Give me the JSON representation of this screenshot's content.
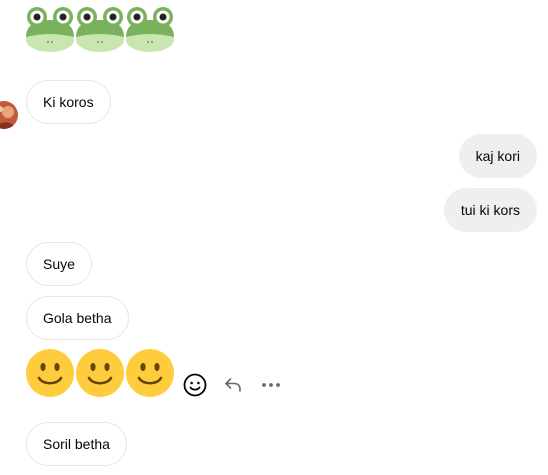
{
  "messages": [
    {
      "kind": "emoji",
      "direction": "incoming",
      "icon": "frog-emoji",
      "count": 3
    },
    {
      "kind": "text",
      "direction": "incoming",
      "text": "Ki koros"
    },
    {
      "kind": "text",
      "direction": "outgoing",
      "text": "kaj kori"
    },
    {
      "kind": "text",
      "direction": "outgoing",
      "text": "tui ki kors"
    },
    {
      "kind": "text",
      "direction": "incoming",
      "text": "Suye"
    },
    {
      "kind": "text",
      "direction": "incoming",
      "text": "Gola betha"
    },
    {
      "kind": "emoji",
      "direction": "incoming",
      "icon": "slightly-smiling-face-emoji",
      "count": 3
    },
    {
      "kind": "text",
      "direction": "incoming",
      "text": "Soril betha"
    }
  ],
  "message_actions": [
    "react-icon",
    "reply-icon",
    "more-options-icon"
  ],
  "colors": {
    "incoming_bubble": "#ffffff",
    "incoming_border": "#e4e6eb",
    "outgoing_bubble": "#efefef",
    "text": "#050505",
    "action_icon": "#65676b"
  }
}
